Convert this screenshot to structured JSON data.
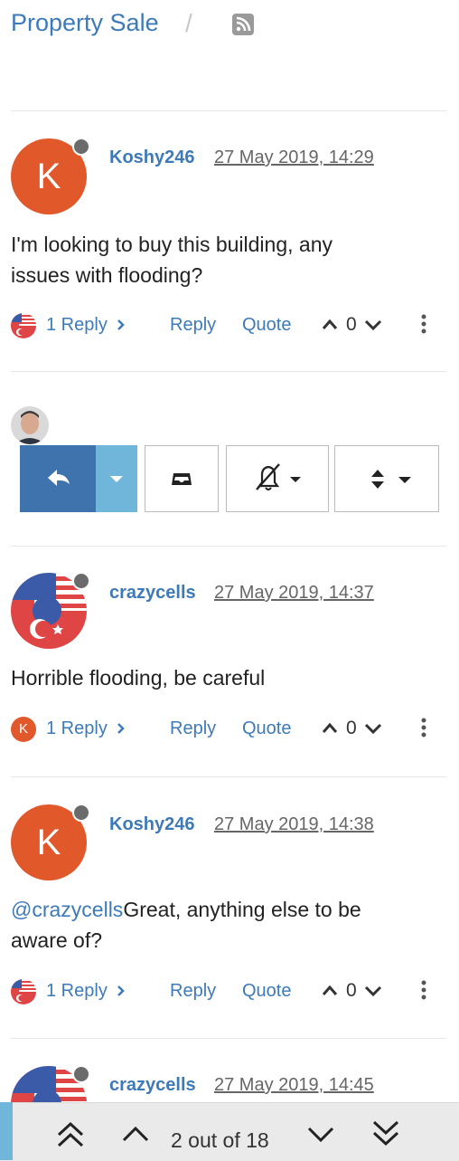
{
  "header": {
    "title": "Property Sale",
    "separator": "/"
  },
  "posts": [
    {
      "avatar_letter": "K",
      "username": "Koshy246",
      "timestamp": "27 May 2019, 14:29",
      "body_lines": [
        "I'm looking to buy this building, any",
        "issues with flooding?"
      ],
      "replies_label": "1 Reply",
      "reply_label": "Reply",
      "quote_label": "Quote",
      "votes": "0"
    },
    {
      "username": "crazycells",
      "timestamp": "27 May 2019, 14:37",
      "body_lines": [
        "Horrible flooding, be careful"
      ],
      "replies_label": "1 Reply",
      "reply_label": "Reply",
      "quote_label": "Quote",
      "votes": "0",
      "reply_avatar_letter": "K"
    },
    {
      "avatar_letter": "K",
      "username": "Koshy246",
      "timestamp": "27 May 2019, 14:38",
      "mention": "@crazycells",
      "body_first_rest": "Great, anything else to be",
      "body_second": "aware of?",
      "replies_label": "1 Reply",
      "reply_label": "Reply",
      "quote_label": "Quote",
      "votes": "0"
    },
    {
      "username": "crazycells",
      "timestamp": "27 May 2019, 14:45"
    }
  ],
  "pager": {
    "label": "2 out of 18"
  },
  "colors": {
    "accent": "#3d7ab8",
    "avatar_orange": "#e1592b",
    "reply_button": "#3f73ad",
    "dropdown_button": "#6fb6da"
  }
}
